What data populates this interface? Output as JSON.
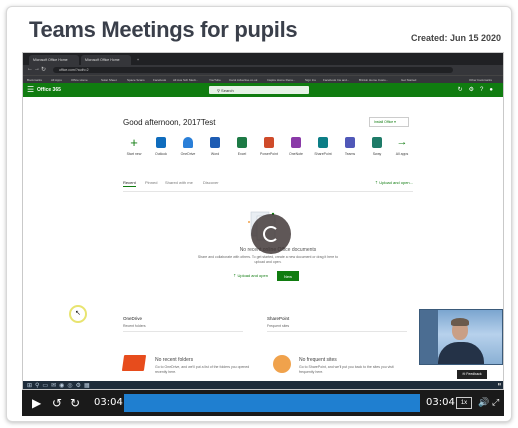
{
  "slide": {
    "title": "Teams Meetings for pupils",
    "created": "Created: Jun 15 2020"
  },
  "browser": {
    "tabs": [
      "Microsoft Office Home",
      "Microsoft Office Home"
    ],
    "new_tab": "+",
    "url": "office.com/?auth=2",
    "bookmarks": [
      "Bookmarks",
      "All Apps",
      "Office Home",
      "Solar Sheet",
      "Space Scans",
      "Facebook",
      "All Aus Sch Medi...",
      "YouTube",
      "Carol Advertise.co.uk",
      "Inspire Home Rena...",
      "Sign Ins",
      "Facebook Ins and...",
      "Brinkin Home Custo...",
      "Get Started",
      "Other bookmarks"
    ]
  },
  "office": {
    "app_name": "Office 365",
    "search_placeholder": "Search",
    "greeting": "Good afternoon, 2017Test",
    "install_label": "Install Office",
    "apps": [
      {
        "label": "Start new",
        "icon": "plus-icon",
        "color": "#107c10"
      },
      {
        "label": "Outlook",
        "icon": "outlook-icon",
        "color": "#0f6cbd"
      },
      {
        "label": "OneDrive",
        "icon": "onedrive-icon",
        "color": "#2a7fd8"
      },
      {
        "label": "Word",
        "icon": "word-icon",
        "color": "#1e5cb3"
      },
      {
        "label": "Excel",
        "icon": "excel-icon",
        "color": "#1d7a45"
      },
      {
        "label": "PowerPoint",
        "icon": "powerpoint-icon",
        "color": "#cf4b2a"
      },
      {
        "label": "OneNote",
        "icon": "onenote-icon",
        "color": "#8a3aa8"
      },
      {
        "label": "SharePoint",
        "icon": "sharepoint-icon",
        "color": "#0c7e86"
      },
      {
        "label": "Teams",
        "icon": "teams-icon",
        "color": "#5058b8"
      },
      {
        "label": "Sway",
        "icon": "sway-icon",
        "color": "#1e7b68"
      },
      {
        "label": "All apps",
        "icon": "arrow-right-icon",
        "color": "#107c10"
      }
    ],
    "filters": [
      "Recent",
      "Pinned",
      "Shared with me",
      "Discover"
    ],
    "upload_open": "Upload and open...",
    "empty": {
      "title": "No recent online Office documents",
      "text": "Share and collaborate with others. To get started, create a new document or drag it here to upload and open.",
      "upload_label": "Upload and open",
      "new_label": "New"
    },
    "onedrive": {
      "title": "OneDrive",
      "subtitle": "Recent folders",
      "empty_title": "No recent folders",
      "empty_text": "Go to OneDrive, and we'll put a list of the folders you opened recently here."
    },
    "sharepoint": {
      "title": "SharePoint",
      "subtitle": "Frequent sites",
      "empty_title": "No frequent sites",
      "empty_text": "Go to SharePoint, and we'll put you back to the sites you visit frequently here."
    },
    "feedback": "Feedback"
  },
  "player": {
    "current_time": "03:04",
    "end_time": "03:04",
    "speed": "1x",
    "progress": 1.0
  }
}
